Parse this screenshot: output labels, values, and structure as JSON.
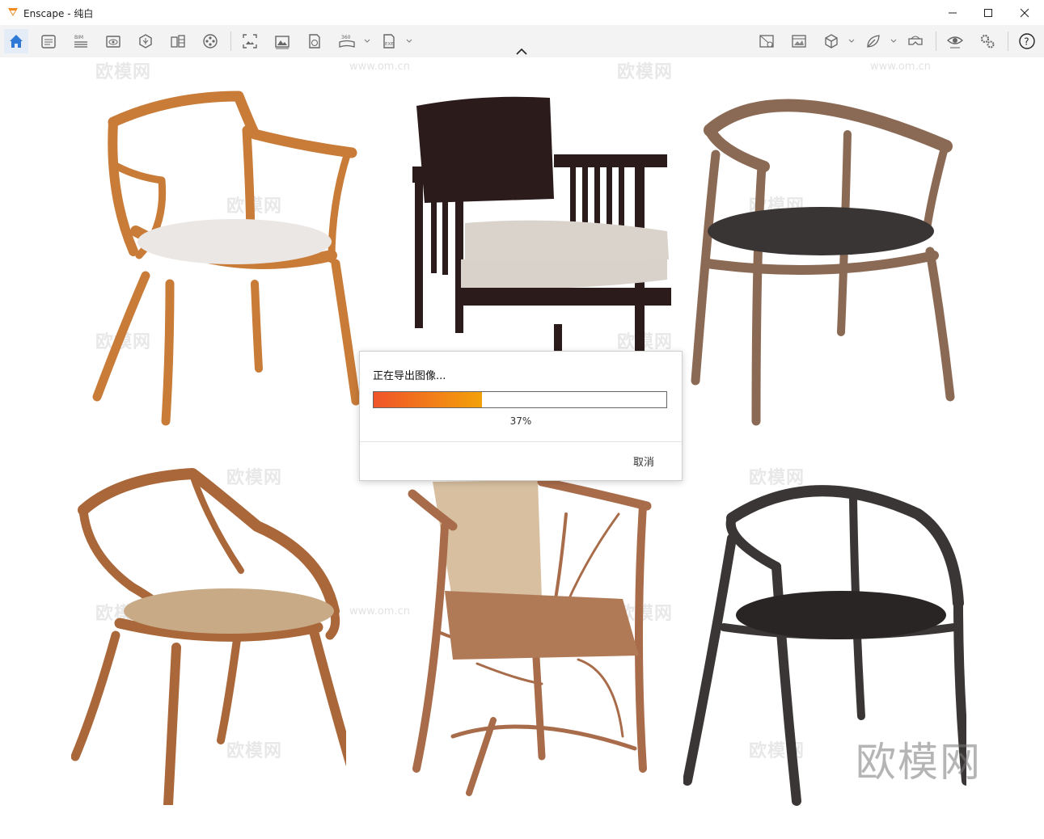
{
  "window": {
    "title": "Enscape - 纯白",
    "logo_icon": "enscape-logo-icon",
    "controls": [
      "minimize-icon",
      "maximize-icon",
      "close-icon"
    ]
  },
  "toolbar": {
    "left_tools": [
      "home-icon",
      "project-info-icon",
      "bim-icon",
      "view-icon",
      "asset-library-icon",
      "material-editor-icon",
      "video-editor-icon",
      "screenshot-icon",
      "batch-render-icon",
      "web-standalone-icon",
      "panorama-360-icon",
      "exe-export-icon"
    ],
    "bim_label": "BIM",
    "pano_label": "360",
    "exe_label": "EXE",
    "right_tools": [
      "views-manager-icon",
      "atmosphere-icon",
      "cube-icon",
      "leaf-icon",
      "vr-headset-icon",
      "visual-settings-icon",
      "settings-gears-icon",
      "help-icon"
    ],
    "accent": "#2f7ad6"
  },
  "watermark": {
    "text": "欧模网",
    "url": "www.om.cn",
    "brand": "欧模网"
  },
  "chairs": [
    {
      "name": "chair-natural-wood-white-seat",
      "frame": "#cc7f3d",
      "seat": "#eae6e3"
    },
    {
      "name": "chair-dark-wood-slatted",
      "frame": "#2a1a1a",
      "seat": "#d9d3cb"
    },
    {
      "name": "chair-grey-wood-dark-seat",
      "frame": "#8b6a55",
      "seat": "#3a3535"
    },
    {
      "name": "chair-walnut-curved",
      "frame": "#a9673a",
      "seat": "#c8aa86"
    },
    {
      "name": "chair-rattan-back",
      "frame": "#a86c4a",
      "seat": "#b07a57"
    },
    {
      "name": "chair-charcoal-round",
      "frame": "#3b3636",
      "seat": "#2a2525"
    }
  ],
  "dialog": {
    "message": "正在导出图像...",
    "progress": 0.37,
    "percent_text": "37%",
    "cancel_label": "取消"
  }
}
